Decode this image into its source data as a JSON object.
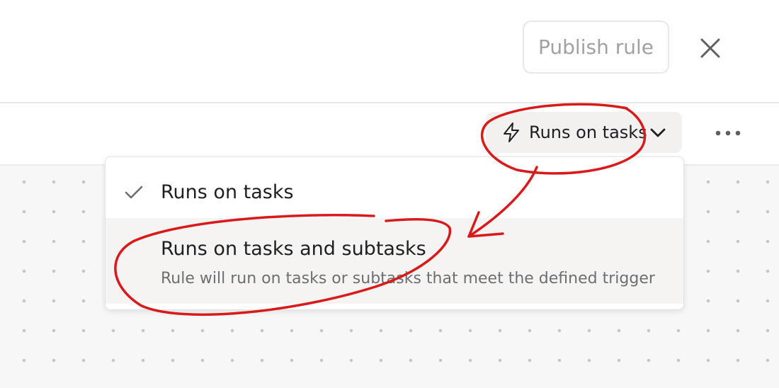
{
  "header": {
    "publish_label": "Publish rule",
    "close_icon": "close-icon"
  },
  "toolbar": {
    "runs_button_label": "Runs on tasks",
    "runs_button_icon": "lightning-bolt-icon",
    "dropdown_icon": "chevron-down-icon",
    "more_icon": "more-horizontal-icon"
  },
  "dropdown": {
    "options": [
      {
        "label": "Runs on tasks",
        "selected": true,
        "icon": "checkmark-icon"
      },
      {
        "label": "Runs on tasks and subtasks",
        "description": "Rule will run on tasks or subtasks that meet the defined trigger",
        "selected": false
      }
    ]
  },
  "colors": {
    "annotation": "#d91a1a",
    "text": "#1e1f21",
    "muted": "#6d6e6f",
    "hover_bg": "#f5f4f3"
  }
}
